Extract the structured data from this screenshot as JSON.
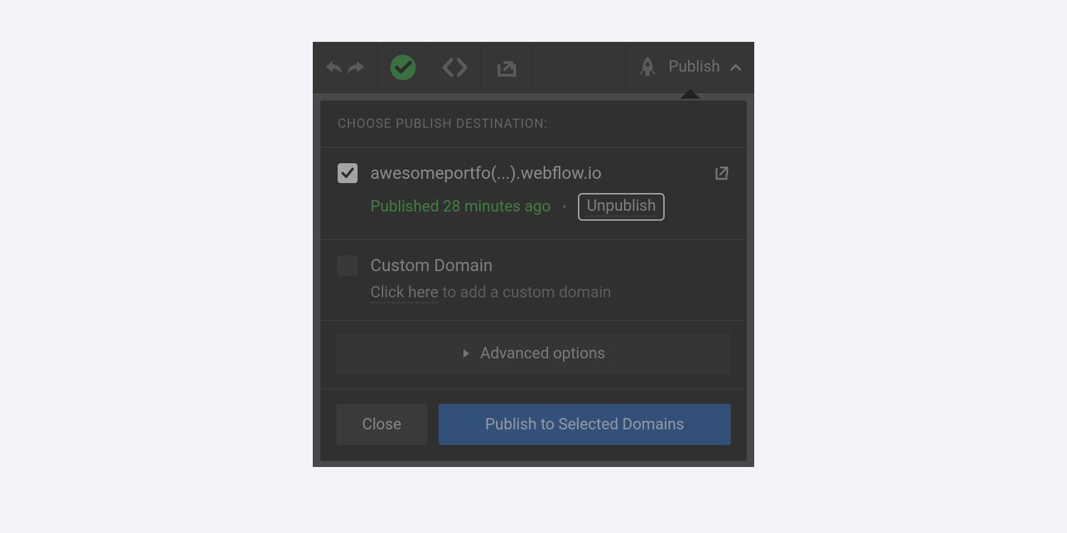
{
  "toolbar": {
    "publish_label": "Publish"
  },
  "dropdown": {
    "heading": "CHOOSE PUBLISH DESTINATION:",
    "destinations": [
      {
        "checked": true,
        "domain": "awesomeportfo(...).webflow.io",
        "status": "Published 28 minutes ago",
        "unpublish_label": "Unpublish"
      },
      {
        "checked": false,
        "title": "Custom Domain",
        "link_text": "Click here",
        "sub_rest": " to add a custom domain"
      }
    ],
    "advanced_label": "Advanced options",
    "close_label": "Close",
    "publish_btn_label": "Publish to Selected Domains"
  }
}
